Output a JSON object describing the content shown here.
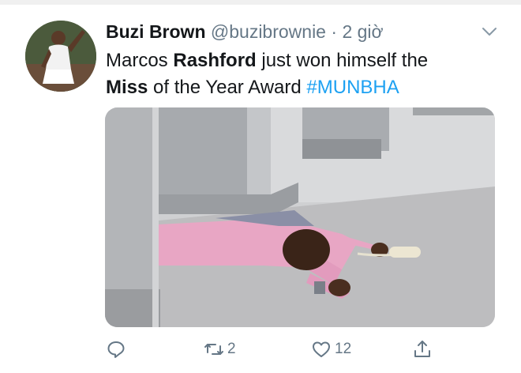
{
  "tweet": {
    "author_name": "Buzi Brown",
    "author_handle": "@buzibrownie",
    "separator": "·",
    "time": "2 giờ",
    "text": {
      "part1": "Marcos ",
      "bold1": "Rashford",
      "part2": " just won himself the ",
      "bold2": "Miss",
      "part3": " of the Year Award ",
      "hashtag": "#MUNBHA"
    },
    "media_icon": "photo-office-man-lying-on-floor"
  },
  "actions": {
    "reply_icon": "reply-icon",
    "retweet_icon": "retweet-icon",
    "retweet_count": "2",
    "like_icon": "heart-icon",
    "like_count": "12",
    "share_icon": "share-icon"
  },
  "colors": {
    "text": "#14171a",
    "muted": "#657786",
    "link": "#1da1f2"
  }
}
